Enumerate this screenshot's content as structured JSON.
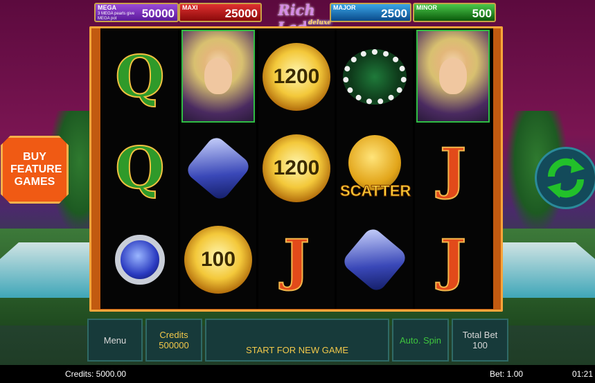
{
  "jackpots": {
    "mega": {
      "label": "MEGA",
      "value": "50000",
      "note": "3 MEGA pearls give MEGA pot",
      "color": "#7a2ab8"
    },
    "maxi": {
      "label": "MAXI",
      "value": "25000",
      "color": "#c0181c"
    },
    "major": {
      "label": "MAJOR",
      "value": "2500",
      "color": "#1a7ab8"
    },
    "minor": {
      "label": "MINOR",
      "value": "500",
      "color": "#2a8a2a"
    }
  },
  "logo": {
    "title": "Rich Lady",
    "subtitle": "deluxe"
  },
  "side_button": {
    "label": "BUY FEATURE GAMES"
  },
  "reels": [
    [
      {
        "icon": "queen-green-icon",
        "text": "Q"
      },
      {
        "icon": "queen-green-icon",
        "text": "Q"
      },
      {
        "icon": "sapphire-ring-icon",
        "text": ""
      }
    ],
    [
      {
        "icon": "rich-lady-icon",
        "text": ""
      },
      {
        "icon": "diamond-pendant-icon",
        "text": ""
      },
      {
        "icon": "gold-orb-icon",
        "text": "100"
      }
    ],
    [
      {
        "icon": "gold-orb-icon",
        "text": "1200"
      },
      {
        "icon": "gold-orb-icon",
        "text": "1200"
      },
      {
        "icon": "jack-red-icon",
        "text": "J"
      }
    ],
    [
      {
        "icon": "pearl-necklace-icon",
        "text": ""
      },
      {
        "icon": "scatter-coin-icon",
        "text": "SCATTER"
      },
      {
        "icon": "diamond-pendant-icon",
        "text": ""
      }
    ],
    [
      {
        "icon": "rich-lady-icon",
        "text": ""
      },
      {
        "icon": "jack-red-icon",
        "text": "J"
      },
      {
        "icon": "jack-red-icon",
        "text": "J"
      }
    ]
  ],
  "controls": {
    "menu": "Menu",
    "credits_label": "Credits",
    "credits_value": "500000",
    "start": "START FOR NEW GAME",
    "auto_spin": "Auto. Spin",
    "total_bet_label": "Total Bet",
    "total_bet_value": "100"
  },
  "status": {
    "credits": "Credits: 5000.00",
    "bet": "Bet: 1.00",
    "time": "01:21"
  },
  "colors": {
    "frame": "#c25a10",
    "panel": "#173a3a",
    "accent": "#f2c84a",
    "spin_arrows": "#22c02a"
  }
}
